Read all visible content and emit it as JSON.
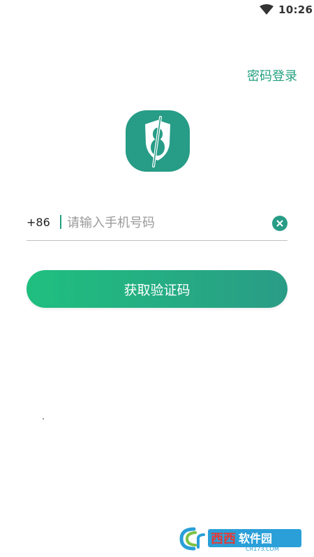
{
  "status_bar": {
    "time": "10:26",
    "wifi_icon": "wifi-icon"
  },
  "header": {
    "password_login_label": "密码登录"
  },
  "logo": {
    "icon": "shield-logo-icon",
    "background_color": "#279c86"
  },
  "phone_input": {
    "country_code": "+86",
    "value": "",
    "placeholder": "请输入手机号码",
    "clear_icon": "clear-icon"
  },
  "actions": {
    "get_code_label": "获取验证码"
  },
  "watermark": {
    "brand": "西西软件园",
    "domain": "CR173.COM"
  },
  "colors": {
    "accent": "#23a07f",
    "button_gradient_start": "#1fbf7f",
    "button_gradient_end": "#2a9c86"
  }
}
